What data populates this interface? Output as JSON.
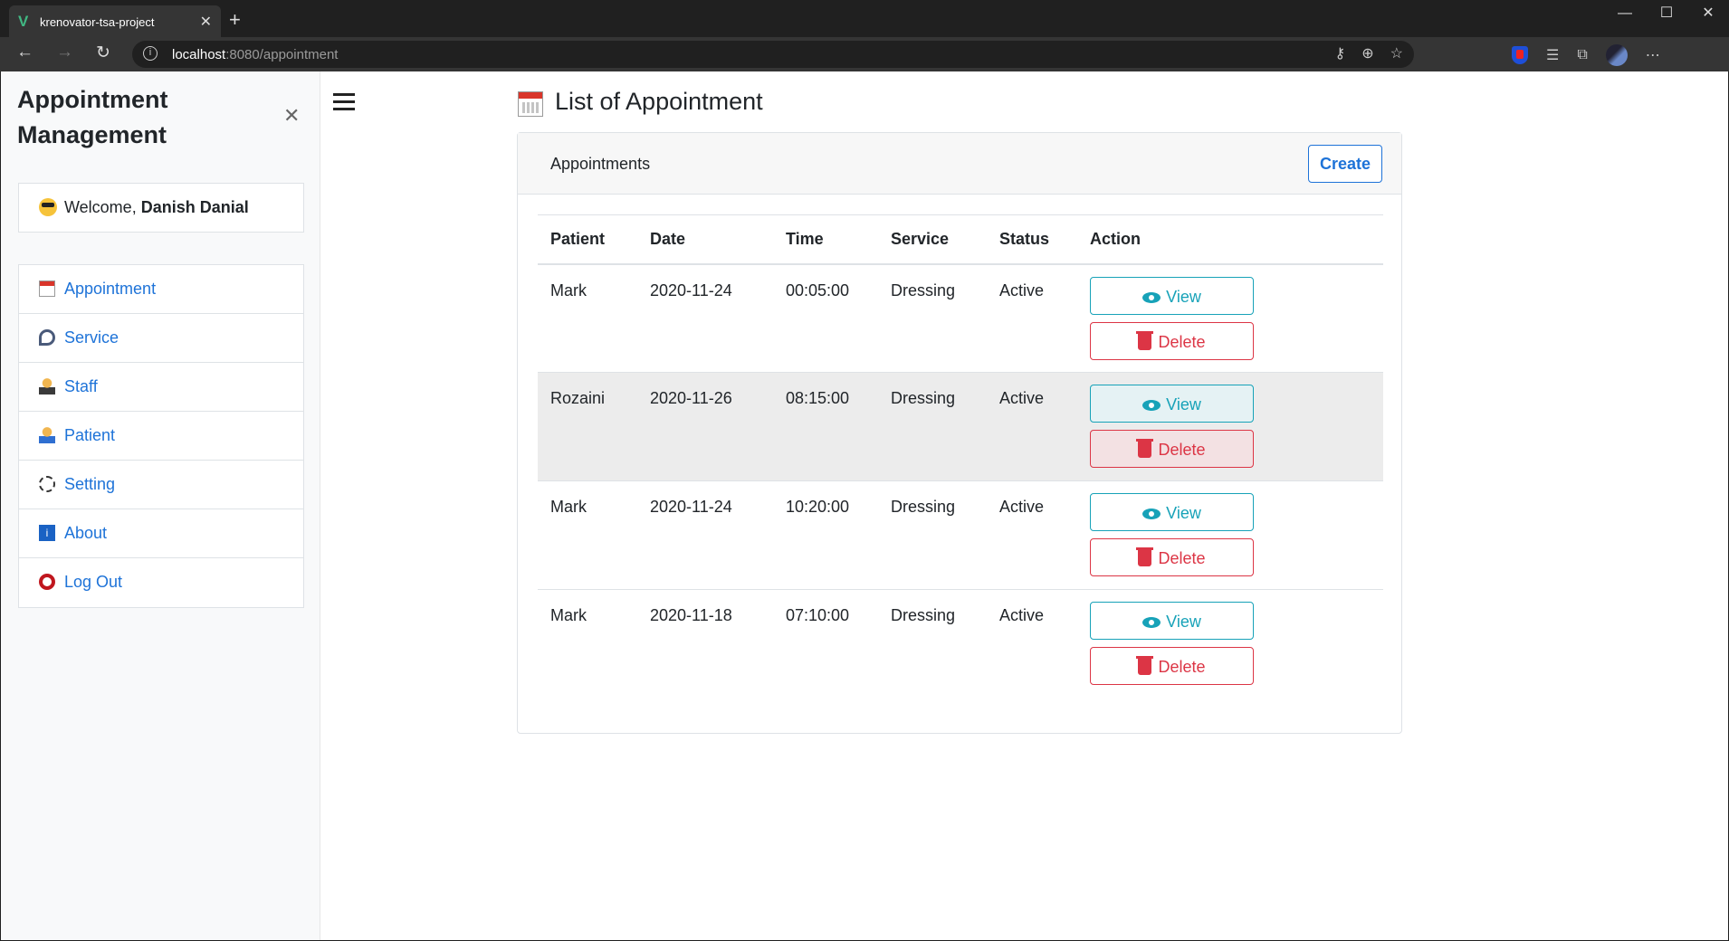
{
  "browser": {
    "tab_title": "krenovator-tsa-project",
    "url_host": "localhost",
    "url_rest": ":8080/appointment"
  },
  "sidebar": {
    "brand_line1": "Appointment",
    "brand_line2": "Management",
    "welcome_prefix": "Welcome,",
    "user_name": "Danish Danial",
    "items": [
      {
        "label": "Appointment",
        "icon": "calendar-icon"
      },
      {
        "label": "Service",
        "icon": "stethoscope-icon"
      },
      {
        "label": "Staff",
        "icon": "staff-icon"
      },
      {
        "label": "Patient",
        "icon": "patient-icon"
      },
      {
        "label": "Setting",
        "icon": "gear-icon"
      },
      {
        "label": "About",
        "icon": "info-icon"
      },
      {
        "label": "Log Out",
        "icon": "logout-icon"
      }
    ]
  },
  "main": {
    "title": "List of Appointment",
    "card_title": "Appointments",
    "create_label": "Create",
    "columns": [
      "Patient",
      "Date",
      "Time",
      "Service",
      "Status",
      "Action"
    ],
    "view_label": "View",
    "delete_label": "Delete",
    "rows": [
      {
        "patient": "Mark",
        "date": "2020-11-24",
        "time": "00:05:00",
        "service": "Dressing",
        "status": "Active"
      },
      {
        "patient": "Rozaini",
        "date": "2020-11-26",
        "time": "08:15:00",
        "service": "Dressing",
        "status": "Active"
      },
      {
        "patient": "Mark",
        "date": "2020-11-24",
        "time": "10:20:00",
        "service": "Dressing",
        "status": "Active"
      },
      {
        "patient": "Mark",
        "date": "2020-11-18",
        "time": "07:10:00",
        "service": "Dressing",
        "status": "Active"
      }
    ]
  },
  "colors": {
    "primary": "#1e73d8",
    "info": "#17a2b8",
    "danger": "#dc3545"
  }
}
